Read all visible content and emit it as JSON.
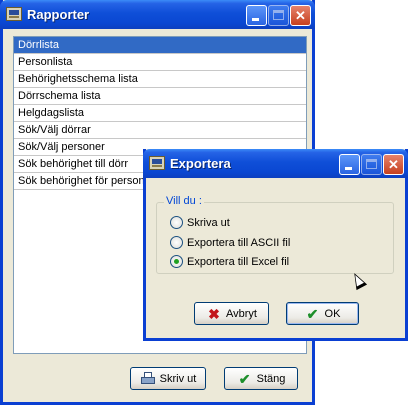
{
  "main_window": {
    "title": "Rapporter",
    "list_items": [
      "Dörrlista",
      "Personlista",
      "Behörighetsschema lista",
      "Dörrschema lista",
      "Helgdagslista",
      "Sök/Välj dörrar",
      "Sök/Välj personer",
      "Sök behörighet till dörr",
      "Sök behörighet för person"
    ],
    "selected_item": "Dörrlista",
    "print_button": "Skriv ut",
    "close_button": "Stäng"
  },
  "export_dialog": {
    "title": "Exportera",
    "group_label": "Vill du :",
    "options": [
      "Skriva ut",
      "Exportera till ASCII fil",
      "Exportera till Excel fil"
    ],
    "selected_option": "Exportera till Excel fil",
    "cancel_button": "Avbryt",
    "ok_button": "OK"
  },
  "colors": {
    "titlebar": "#0a47d2",
    "selection": "#316ac5",
    "window_bg": "#ece9d8",
    "close_button": "#c6401f"
  },
  "icons": {
    "app": "app-icon",
    "minimize": "minimize-icon",
    "maximize": "maximize-icon",
    "close": "close-icon",
    "print": "printer-icon",
    "check": "checkmark-icon",
    "cancel": "red-x-icon"
  }
}
